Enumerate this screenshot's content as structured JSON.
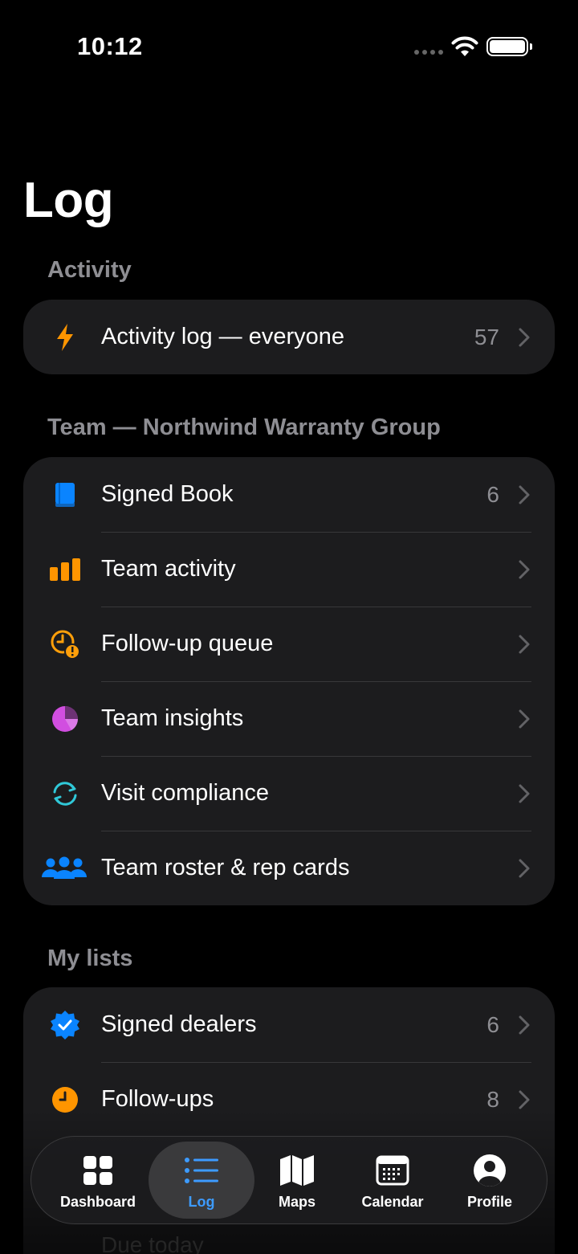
{
  "status_bar": {
    "time": "10:12"
  },
  "page": {
    "title": "Log"
  },
  "sections": {
    "activity": {
      "header": "Activity",
      "rows": [
        {
          "label": "Activity log — everyone",
          "count": "57",
          "icon": "bolt-icon",
          "color": "#ff9500"
        }
      ]
    },
    "team": {
      "header": "Team — Northwind Warranty Group",
      "rows": [
        {
          "label": "Signed Book",
          "count": "6",
          "icon": "book-icon",
          "color": "#0a84ff"
        },
        {
          "label": "Team activity",
          "count": "",
          "icon": "bar-chart-icon",
          "color": "#ff9500"
        },
        {
          "label": "Follow-up queue",
          "count": "",
          "icon": "clock-alert-icon",
          "color": "#ff9f0a"
        },
        {
          "label": "Team insights",
          "count": "",
          "icon": "pie-chart-icon",
          "color": "#d14ee0"
        },
        {
          "label": "Visit compliance",
          "count": "",
          "icon": "sync-icon",
          "color": "#30c8d8"
        },
        {
          "label": "Team roster & rep cards",
          "count": "",
          "icon": "people-icon",
          "color": "#0a84ff"
        }
      ]
    },
    "my_lists": {
      "header": "My lists",
      "rows": [
        {
          "label": "Signed dealers",
          "count": "6",
          "icon": "verified-badge-icon",
          "color": "#0a84ff"
        },
        {
          "label": "Follow-ups",
          "count": "8",
          "icon": "clock-icon",
          "color": "#ff9500"
        }
      ],
      "peek_label": "Due today"
    }
  },
  "tab_bar": {
    "tabs": [
      {
        "label": "Dashboard",
        "icon": "grid-icon"
      },
      {
        "label": "Log",
        "icon": "list-icon",
        "active": true
      },
      {
        "label": "Maps",
        "icon": "map-icon"
      },
      {
        "label": "Calendar",
        "icon": "calendar-icon"
      },
      {
        "label": "Profile",
        "icon": "person-icon"
      }
    ]
  }
}
